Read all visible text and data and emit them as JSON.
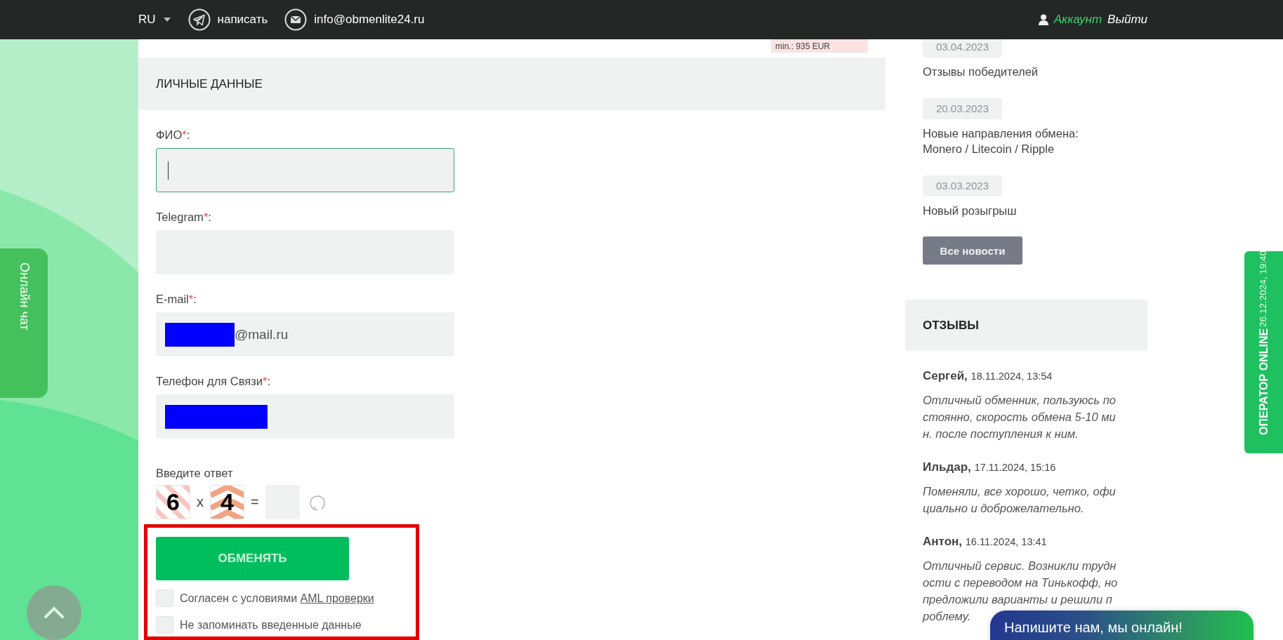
{
  "top_bar": {
    "language": "RU",
    "contacts": [
      {
        "kind": "telegram",
        "label": "написать"
      },
      {
        "kind": "email",
        "label": "info@obmenlite24.ru"
      }
    ],
    "account": "Аккаунт",
    "logout": "Выйти"
  },
  "limit_note": "min.: 935 EUR",
  "form": {
    "title": "ЛИЧНЫЕ ДАННЫЕ",
    "fields": [
      {
        "label": "ФИО",
        "required_mark": "*",
        "label_end": ":",
        "focused": true,
        "redacted": false
      },
      {
        "label": "Telegram",
        "required_mark": "*",
        "label_end": ":",
        "focused": false,
        "redacted": false
      },
      {
        "label": "E-mail",
        "required_mark": "*",
        "label_end": ":",
        "focused": false,
        "redacted": true,
        "value": "@mail.ru"
      },
      {
        "label": "Телефон для Связи",
        "required_mark": "*",
        "label_end": ":",
        "focused": false,
        "redacted": true
      }
    ],
    "captcha": {
      "label": "Введите ответ",
      "operands": [
        {
          "value": "6",
          "kind": "stripes"
        },
        {
          "value": "4",
          "kind": "chevrons"
        }
      ],
      "operator": "x",
      "equals": "="
    },
    "submit_area": {
      "highlighted": true,
      "button": "ОБМЕНЯТЬ",
      "agreements": [
        {
          "text": "Согласен с условиями ",
          "link": "AML проверки",
          "checked": false
        },
        {
          "text": "Не запоминать введенные данные",
          "checked": false
        }
      ]
    }
  },
  "news": {
    "items": [
      {
        "date": "03.04.2023",
        "title": "Отзывы победителей"
      },
      {
        "date": "20.03.2023",
        "title": "Новые направления обмена: Monero / Litecoin / Ripple"
      },
      {
        "date": "03.03.2023",
        "title": "Новый розыгрыш"
      }
    ],
    "all_button": "Все новости"
  },
  "reviews": {
    "title": "ОТЗЫВЫ",
    "items": [
      {
        "name": "Сергей,",
        "date": "18.11.2024, 13:54",
        "lines": [
          "Отличный обменник, пользуюсь по",
          "стоянно, скорость обмена 5-10 ми",
          "н. после поступления к ним."
        ]
      },
      {
        "name": "Ильдар,",
        "date": "17.11.2024, 15:16",
        "lines": [
          "Поменяли, все хорошо, четко, офи",
          "циально и доброжелательно."
        ]
      },
      {
        "name": "Антон,",
        "date": "16.11.2024, 13:41",
        "lines": [
          "Отличный сервис. Возникли трудн",
          "ости с переводом на Тинькофф, но",
          "предложили варианты и решили п",
          "роблему."
        ]
      }
    ]
  },
  "online_chat_tab": "Онлайн чат",
  "operator_tab": {
    "title": "ОПЕРАТОР ONLINE",
    "time": "26.12.2024, 19:40"
  },
  "chat_widget": "Напишите нам, мы онлайн!"
}
